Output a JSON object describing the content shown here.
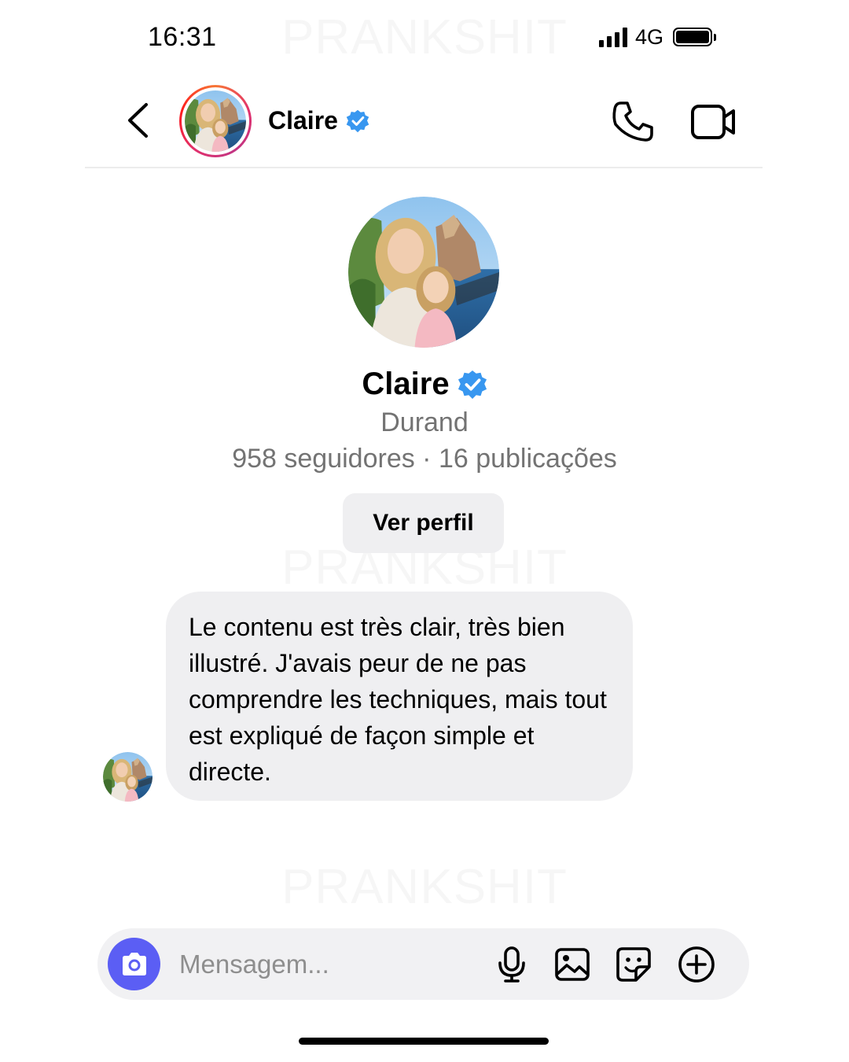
{
  "watermark": "PRANKSHIT",
  "status_bar": {
    "time": "16:31",
    "network": "4G"
  },
  "header": {
    "contact_name": "Claire",
    "verified": true,
    "avatar_icon": "contact-avatar-photo",
    "back_icon": "chevron-left-icon",
    "call_icon": "phone-icon",
    "video_icon": "video-camera-icon"
  },
  "profile": {
    "name": "Claire",
    "subtitle": "Durand",
    "stats": "958 seguidores · 16 publicações",
    "view_profile_label": "Ver perfil"
  },
  "messages": [
    {
      "sender": "Claire",
      "text": "Le contenu est très clair, très bien illustré. J'avais peur de ne pas comprendre les techniques, mais tout est expliqué de façon simple et directe."
    }
  ],
  "composer": {
    "placeholder": "Mensagem...",
    "camera_icon": "camera-icon",
    "actions": [
      "microphone-icon",
      "image-icon",
      "sticker-icon",
      "plus-circle-icon"
    ]
  },
  "colors": {
    "verified_badge": "#3897f0",
    "camera_button": "#5b5ef4",
    "bubble_bg": "#efeff1",
    "secondary_text": "#737373"
  }
}
